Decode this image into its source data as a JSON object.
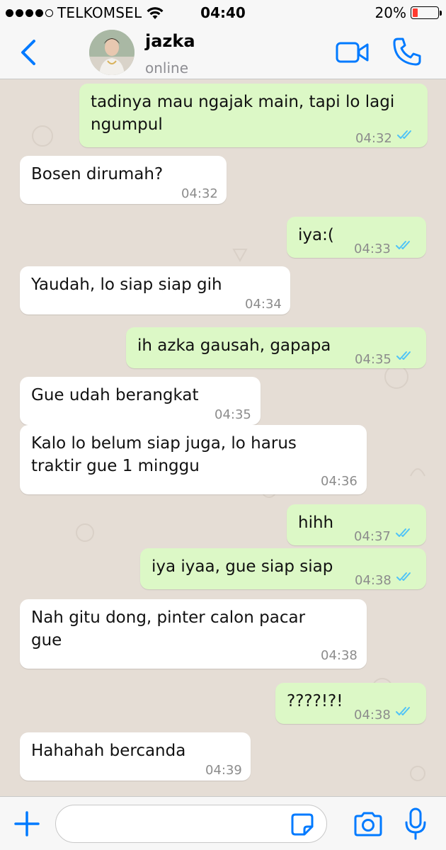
{
  "status_bar": {
    "carrier": "TELKOMSEL",
    "time": "04:40",
    "battery": "20%",
    "battery_level": 0.2,
    "signal_bars": 4
  },
  "header": {
    "contact_name": "jazka",
    "contact_status": "online",
    "accent_color": "#007aff"
  },
  "messages": [
    {
      "direction": "out",
      "lines": [
        "tadinya mau ngajak main, tapi lo lagi",
        "ngumpul"
      ],
      "time": "04:32",
      "read": true
    },
    {
      "direction": "in",
      "lines": [
        "Bosen dirumah?"
      ],
      "time": "04:32"
    },
    {
      "direction": "out",
      "lines": [
        "iya:("
      ],
      "time": "04:33",
      "read": true
    },
    {
      "direction": "in",
      "lines": [
        "Yaudah, lo siap siap gih"
      ],
      "time": "04:34"
    },
    {
      "direction": "out",
      "lines": [
        "ih azka gausah, gapapa"
      ],
      "time": "04:35",
      "read": true
    },
    {
      "direction": "in",
      "lines": [
        "Gue udah berangkat"
      ],
      "time": "04:35"
    },
    {
      "direction": "in",
      "lines": [
        "Kalo lo belum siap juga, lo harus",
        "traktir gue 1 minggu"
      ],
      "time": "04:36"
    },
    {
      "direction": "out",
      "lines": [
        "hihh"
      ],
      "time": "04:37",
      "read": true
    },
    {
      "direction": "out",
      "lines": [
        "iya iyaa, gue siap siap"
      ],
      "time": "04:38",
      "read": true
    },
    {
      "direction": "in",
      "lines": [
        "Nah gitu dong, pinter calon pacar",
        "gue"
      ],
      "time": "04:38"
    },
    {
      "direction": "out",
      "lines": [
        "????!?!"
      ],
      "time": "04:38",
      "read": true
    },
    {
      "direction": "in",
      "lines": [
        "Hahahah bercanda"
      ],
      "time": "04:39"
    }
  ],
  "input": {
    "value": "",
    "placeholder": ""
  },
  "colors": {
    "outgoing_bubble": "#dcf8c6",
    "incoming_bubble": "#ffffff",
    "read_ticks": "#4fc3f7",
    "chat_background": "#e5ddd5"
  }
}
